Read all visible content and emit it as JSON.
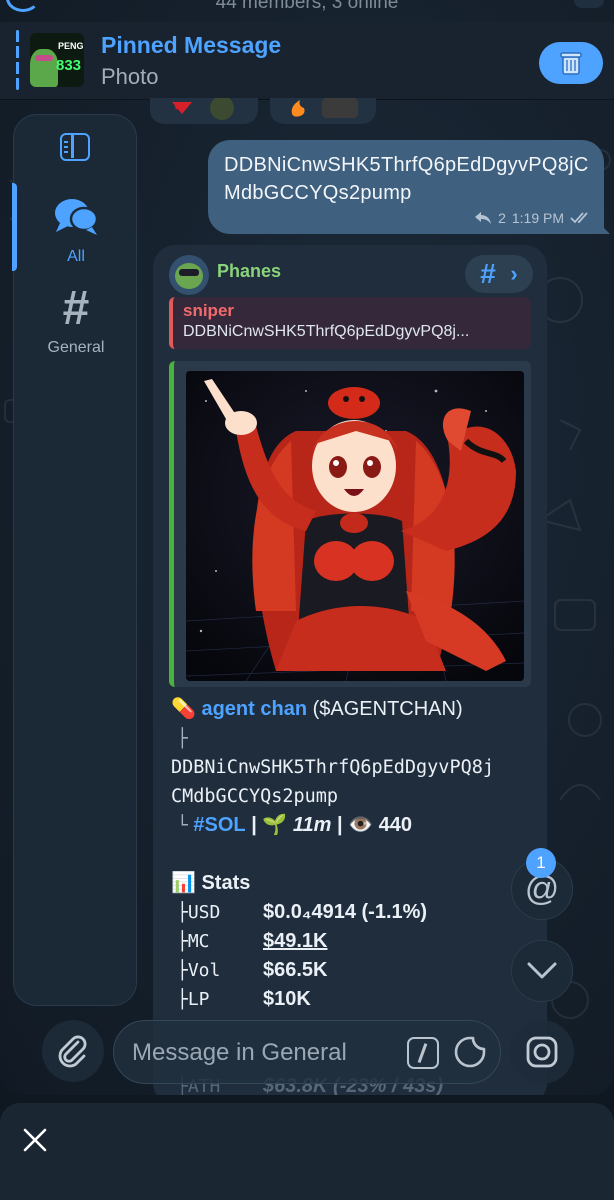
{
  "header": {
    "subtitle": "44 members, 3 online"
  },
  "pinned": {
    "title": "Pinned Message",
    "subtitle": "Photo",
    "thumb_line1": "PENG",
    "thumb_line2": "833"
  },
  "sidebar": {
    "items": [
      {
        "label": "All",
        "icon": "chat-bubbles-icon",
        "active": true
      },
      {
        "label": "General",
        "icon": "hash-icon",
        "active": false
      }
    ]
  },
  "outgoing": {
    "text": "DDBNiCnwSHK5ThrfQ6pEdDgyvPQ8jCMdbGCCYQs2pump",
    "replies": "2",
    "time": "1:19 PM"
  },
  "incoming": {
    "sender": "Phanes",
    "topic_hash": "#",
    "reply": {
      "author": "sniper",
      "text": "DDBNiCnwSHK5ThrfQ6pEdDgyvPQ8j..."
    },
    "caption": {
      "pill_emoji": "💊",
      "token_name": "agent chan",
      "ticker": "($AGENTCHAN)",
      "tree_top": "├",
      "ca_line1": "DDBNiCnwSHK5ThrfQ6pEdDgyvPQ8j",
      "ca_line2": "CMdbGCCYQs2pump",
      "tree_end": "└",
      "chain": "#SOL",
      "sep": "|",
      "sprout_emoji": "🌱",
      "age": "11m",
      "eye_emoji": "👁️",
      "views": "440",
      "stats_emoji": "📊",
      "stats_title": "Stats",
      "stats": [
        {
          "key": "├USD",
          "value": "$0.0₄4914 (-1.1%)"
        },
        {
          "key": "├MC",
          "value": "$49.1K"
        },
        {
          "key": "├Vol",
          "value": "$66.5K"
        },
        {
          "key": "├LP",
          "value": "$10K"
        },
        {
          "key": "├ATH",
          "value": "$63.8K (-23% / 43s)"
        }
      ]
    }
  },
  "floating": {
    "mention_badge": "1",
    "mention_symbol": "@"
  },
  "composer": {
    "placeholder": "Message in General"
  },
  "colors": {
    "accent": "#4da3ff",
    "outgoing_bubble": "#40607f",
    "incoming_bubble": "#1f2d3c",
    "sender_name": "#8bd27b",
    "reply_author": "#f06b6b",
    "media_border": "#49b33a"
  }
}
